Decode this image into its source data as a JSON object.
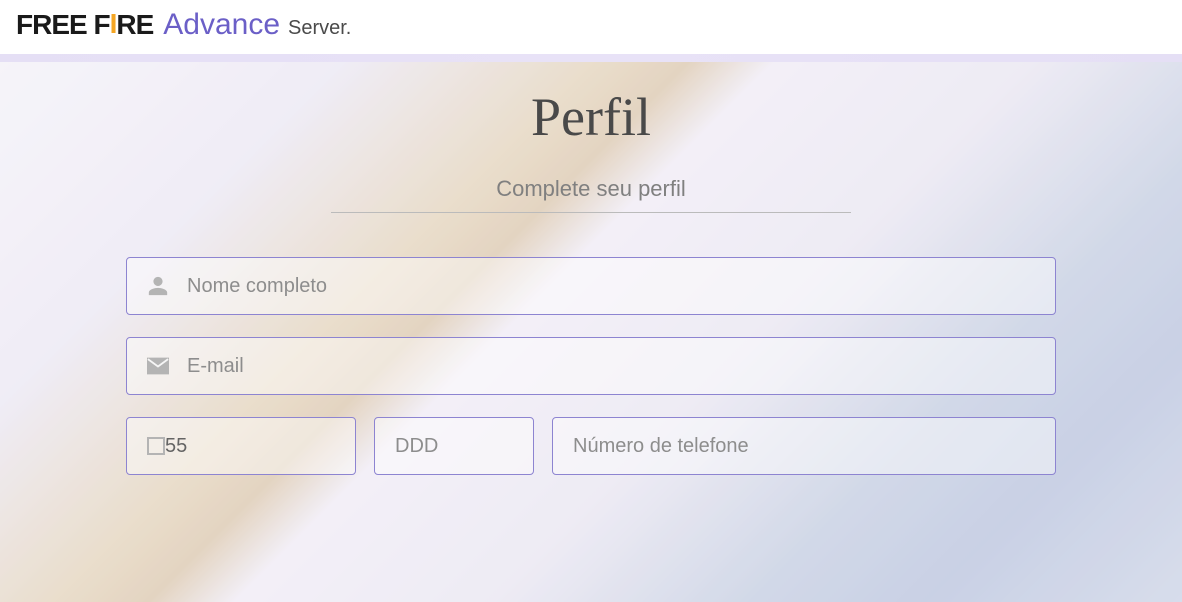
{
  "header": {
    "logo_part1": "FREE F",
    "logo_flame": "I",
    "logo_part2": "RE",
    "logo_advance": "Advance",
    "logo_server": "Server."
  },
  "page": {
    "title": "Perfil",
    "subtitle": "Complete seu perfil"
  },
  "form": {
    "fullname_placeholder": "Nome completo",
    "email_placeholder": "E-mail",
    "country_code_value": "55",
    "ddd_placeholder": "DDD",
    "phone_placeholder": "Número de telefone"
  }
}
